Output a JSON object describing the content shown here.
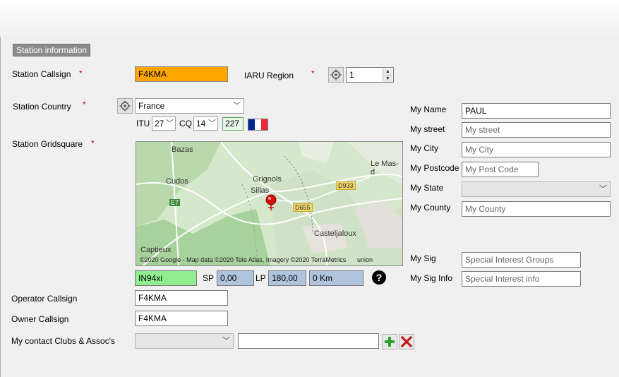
{
  "section": {
    "title": "Station information"
  },
  "station": {
    "callsign_label": "Station Callsign",
    "callsign_value": "F4KMA",
    "required_mark": "*",
    "iaru_label": "IARU Region",
    "iaru_value": "1",
    "country_label": "Station Country",
    "country_value": "France",
    "itu_label": "ITU",
    "itu_value": "27",
    "cq_label": "CQ",
    "cq_value": "14",
    "dxcc_value": "227",
    "gridsquare_label": "Station Gridsquare",
    "gridsquare_value": "IN94xi",
    "sp_label": "SP",
    "sp_value": "0,00",
    "lp_label": "LP",
    "lp_value": "180,00",
    "distance_value": "0 Km",
    "help_symbol": "?"
  },
  "map": {
    "places": [
      "Bazas",
      "Cudos",
      "Grignols",
      "Sillas",
      "Le Mas-d",
      "Casteljaloux",
      "Captieux"
    ],
    "road_labels": [
      "E7",
      "D933",
      "D655"
    ],
    "attribution": "©2020 Google - Map data ©2020 Tele Atlas, Imagery ©2020 TerraMetrics",
    "attribution_tail": "union"
  },
  "operator": {
    "label": "Operator Callsign",
    "value": "F4KMA"
  },
  "owner": {
    "label": "Owner Callsign",
    "value": "F4KMA"
  },
  "clubs": {
    "label": "My contact Clubs & Assoc's",
    "select_value": "",
    "text_value": ""
  },
  "personal": {
    "name_label": "My Name",
    "name_value": "PAUL",
    "street_label": "My street",
    "street_placeholder": "My street",
    "city_label": "My City",
    "city_placeholder": "My City",
    "postcode_label": "My Postcode",
    "postcode_placeholder": "My Post Code",
    "state_label": "My State",
    "state_value": "",
    "county_label": "My County",
    "county_placeholder": "My County",
    "sig_label": "My Sig",
    "sig_placeholder": "Special Interest Groups",
    "siginfo_label": "My Sig Info",
    "siginfo_placeholder": "Special Interest info"
  },
  "colors": {
    "callsign_bg": "#ffa500",
    "gridsquare_bg": "#90ee90",
    "readonly_bg": "#b0c4de",
    "required": "#d40000",
    "flag": [
      "#002395",
      "#ffffff",
      "#ed2939"
    ]
  },
  "icons": {
    "locate": "crosshair-icon",
    "dropdown": "chevron-down-icon",
    "add": "plus-icon",
    "delete": "close-icon",
    "help": "question-circle-icon",
    "marker": "map-pin-icon"
  }
}
